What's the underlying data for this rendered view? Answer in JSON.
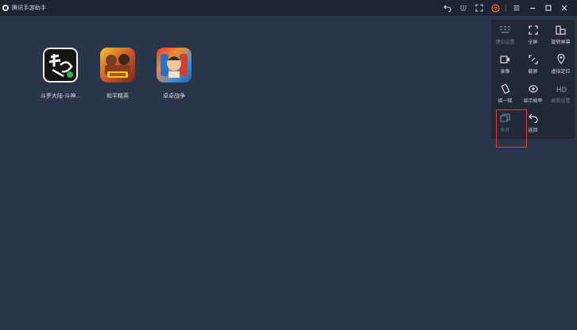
{
  "window": {
    "title": "腾讯手游助手"
  },
  "titlebar_icons": [
    {
      "name": "back-icon"
    },
    {
      "name": "keyboard-icon"
    },
    {
      "name": "fullscreen-icon"
    },
    {
      "name": "skin-icon"
    },
    {
      "name": "menu-icon"
    },
    {
      "name": "minimize-icon"
    },
    {
      "name": "maximize-icon"
    },
    {
      "name": "close-icon"
    }
  ],
  "apps": [
    {
      "name": "斗罗大陆-斗神..."
    },
    {
      "name": "和平精英"
    },
    {
      "name": "卓卓战争"
    }
  ],
  "side_panel": {
    "tools": [
      {
        "label": "键位设置",
        "icon": "keyboard-icon",
        "enabled": false
      },
      {
        "label": "全屏",
        "icon": "fullscreen-icon",
        "enabled": true
      },
      {
        "label": "旋转屏幕",
        "icon": "rotate-screen-icon",
        "enabled": true
      },
      {
        "label": "录像",
        "icon": "video-record-icon",
        "enabled": true
      },
      {
        "label": "截屏",
        "icon": "screenshot-icon",
        "enabled": true
      },
      {
        "label": "虚拟定位",
        "icon": "location-icon",
        "enabled": true
      },
      {
        "label": "摇一摇",
        "icon": "shake-icon",
        "enabled": true
      },
      {
        "label": "显示帧率",
        "icon": "fps-icon",
        "enabled": true
      },
      {
        "label": "画质设置",
        "icon": "hd-icon",
        "enabled": false
      },
      {
        "label": "多开",
        "icon": "multi-instance-icon",
        "enabled": false
      },
      {
        "label": "返回",
        "icon": "return-icon",
        "enabled": true
      }
    ]
  },
  "colors": {
    "background": "#2b3549",
    "titlebar": "#1e2430",
    "panel": "#222936",
    "highlight": "#e33b3b",
    "skin_accent": "#ff6a2b"
  }
}
